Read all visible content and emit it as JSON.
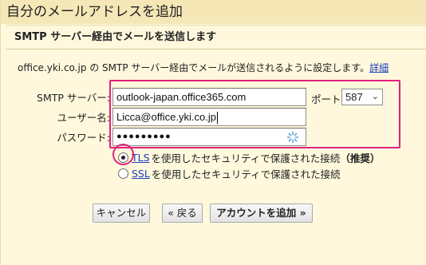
{
  "dialog": {
    "title": "自分のメールアドレスを追加",
    "section_heading": "SMTP サーバー経由でメールを送信します",
    "description": "office.yki.co.jp の SMTP サーバー経由でメールが送信されるように設定します。",
    "details_link": "詳細"
  },
  "form": {
    "smtp_label": "SMTP サーバー:",
    "smtp_value": "outlook-japan.office365.com",
    "port_label": "ポート:",
    "port_value": "587",
    "username_label": "ユーザー名:",
    "username_value": "Licca@office.yki.co.jp",
    "password_label": "パスワード:",
    "password_value": "●●●●●●●●●"
  },
  "security": {
    "tls_link": "TLS",
    "tls_text": "を使用したセキュリティで保護された接続",
    "tls_recommended": "（推奨）",
    "ssl_link": "SSL",
    "ssl_text": "を使用したセキュリティで保護された接続",
    "selected": "TLS"
  },
  "buttons": {
    "cancel": "キャンセル",
    "back": "« 戻る",
    "add_account": "アカウントを追加 »"
  },
  "colors": {
    "dialog_bg": "#fff8dc",
    "title_bg": "#f5e7b6",
    "highlight": "#e0207f",
    "link": "#1a3fbf"
  }
}
